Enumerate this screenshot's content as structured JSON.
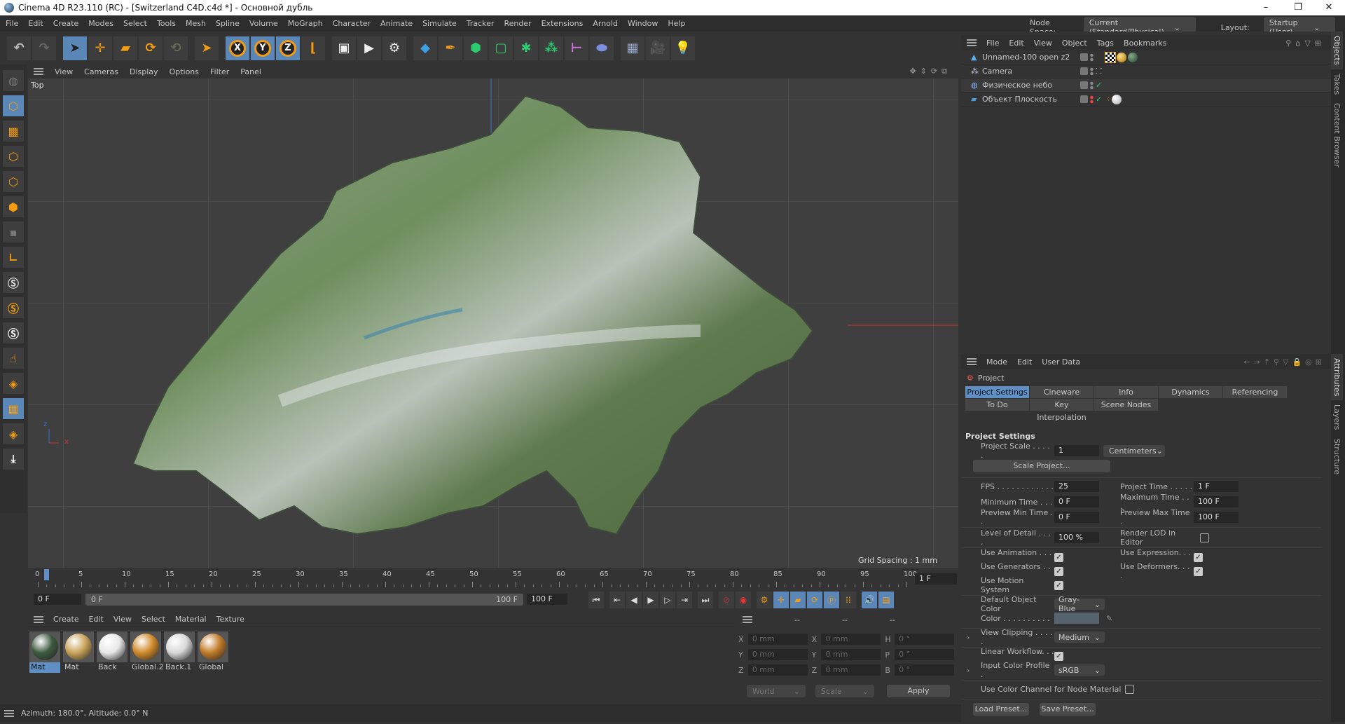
{
  "title": "Cinema 4D R23.110 (RC) - [Switzerland C4D.c4d *] - Основной дубль",
  "window_controls": [
    "–",
    "❐",
    "✕"
  ],
  "menu": [
    "File",
    "Edit",
    "Create",
    "Modes",
    "Select",
    "Tools",
    "Mesh",
    "Spline",
    "Volume",
    "MoGraph",
    "Character",
    "Animate",
    "Simulate",
    "Tracker",
    "Render",
    "Extensions",
    "Arnold",
    "Window",
    "Help"
  ],
  "node_space": {
    "label": "Node Space:",
    "value": "Current (Standard/Physical)"
  },
  "layout": {
    "label": "Layout:",
    "value": "Startup (User)"
  },
  "toolbar": {
    "axis": [
      "X",
      "Y",
      "Z"
    ]
  },
  "viewport": {
    "menu": [
      "View",
      "Cameras",
      "Display",
      "Options",
      "Filter",
      "Panel"
    ],
    "view_name": "Top",
    "grid_spacing": "Grid Spacing : 1 mm",
    "axis_x": "x",
    "axis_z": "z"
  },
  "objects": {
    "menu": [
      "File",
      "Edit",
      "View",
      "Object",
      "Tags",
      "Bookmarks"
    ],
    "items": [
      {
        "name": "Unnamed-100 open z2"
      },
      {
        "name": "Camera"
      },
      {
        "name": "Физическое небо"
      },
      {
        "name": "Объект Плоскость"
      }
    ]
  },
  "side_tabs_top": [
    "Objects",
    "Takes",
    "Content Browser"
  ],
  "side_tabs_bottom": [
    "Attributes",
    "Layers",
    "Structure"
  ],
  "attributes": {
    "menu": [
      "Mode",
      "Edit",
      "User Data"
    ],
    "object": "Project",
    "tabs": [
      "Project Settings",
      "Cineware",
      "Info",
      "Dynamics",
      "Referencing",
      "To Do",
      "Key Interpolation",
      "Scene Nodes"
    ],
    "section": "Project Settings",
    "project_scale": {
      "label": "Project Scale . . . . .",
      "value": "1",
      "unit": "Centimeters"
    },
    "scale_project": "Scale Project...",
    "fps": {
      "label": "FPS . . . . . . . . . . . .",
      "value": "25"
    },
    "project_time": {
      "label": "Project Time . . . . .",
      "value": "1 F"
    },
    "min_time": {
      "label": "Minimum Time . . .",
      "value": "0 F"
    },
    "max_time": {
      "label": "Maximum Time . . .",
      "value": "100 F"
    },
    "prev_min": {
      "label": "Preview Min Time . .",
      "value": "0 F"
    },
    "prev_max": {
      "label": "Preview Max Time .",
      "value": "100 F"
    },
    "lod": {
      "label": "Level of Detail . . . .",
      "value": "100 %"
    },
    "render_lod": {
      "label": "Render LOD in Editor",
      "checked": false
    },
    "use_animation": {
      "label": "Use Animation . . . .",
      "checked": true
    },
    "use_expression": {
      "label": "Use Expression. . . .",
      "checked": true
    },
    "use_generators": {
      "label": "Use Generators . . .",
      "checked": true
    },
    "use_deformers": {
      "label": "Use Deformers. . . .",
      "checked": true
    },
    "use_motion": {
      "label": "Use Motion System",
      "checked": true
    },
    "default_color": {
      "label": "Default Object Color",
      "value": "Gray-Blue"
    },
    "color": {
      "label": "Color . . . . . . . . . .",
      "swatch": "#566470"
    },
    "view_clipping": {
      "label": "View Clipping . . . . .",
      "value": "Medium"
    },
    "linear_workflow": {
      "label": "Linear Workflow. . . .",
      "checked": true
    },
    "input_profile": {
      "label": "Input Color Profile .",
      "value": "sRGB"
    },
    "color_channel": {
      "label": "Use Color Channel for Node Material",
      "checked": false
    },
    "load_preset": "Load Preset...",
    "save_preset": "Save Preset..."
  },
  "timeline": {
    "ticks": [
      0,
      5,
      10,
      15,
      20,
      25,
      30,
      35,
      40,
      45,
      50,
      55,
      60,
      65,
      70,
      75,
      80,
      85,
      90,
      95,
      100
    ],
    "current_frame": 1,
    "current_field": "1 F",
    "start": "0 F",
    "range_start": "0 F",
    "range_end": "100 F",
    "end": "100 F"
  },
  "materials": {
    "menu": [
      "Create",
      "Edit",
      "View",
      "Select",
      "Material",
      "Texture"
    ],
    "items": [
      {
        "name": "Mat",
        "color": "#3d5a40"
      },
      {
        "name": "Mat",
        "color": "#c9a35a"
      },
      {
        "name": "Back",
        "color": "#e8e8e8"
      },
      {
        "name": "Global.2",
        "color": "#d08a2a"
      },
      {
        "name": "Back.1",
        "color": "#d8d8d8"
      },
      {
        "name": "Global",
        "color": "#c07a28"
      }
    ]
  },
  "coords": {
    "headers": [
      "--",
      "--",
      "--"
    ],
    "rows": [
      [
        "X",
        "0 mm",
        "X",
        "0 mm",
        "H",
        "0 °"
      ],
      [
        "Y",
        "0 mm",
        "Y",
        "0 mm",
        "P",
        "0 °"
      ],
      [
        "Z",
        "0 mm",
        "Z",
        "0 mm",
        "B",
        "0 °"
      ]
    ],
    "space": "World",
    "mode": "Scale",
    "apply": "Apply"
  },
  "status": "Azimuth: 180.0°, Altitude: 0.0°  N"
}
